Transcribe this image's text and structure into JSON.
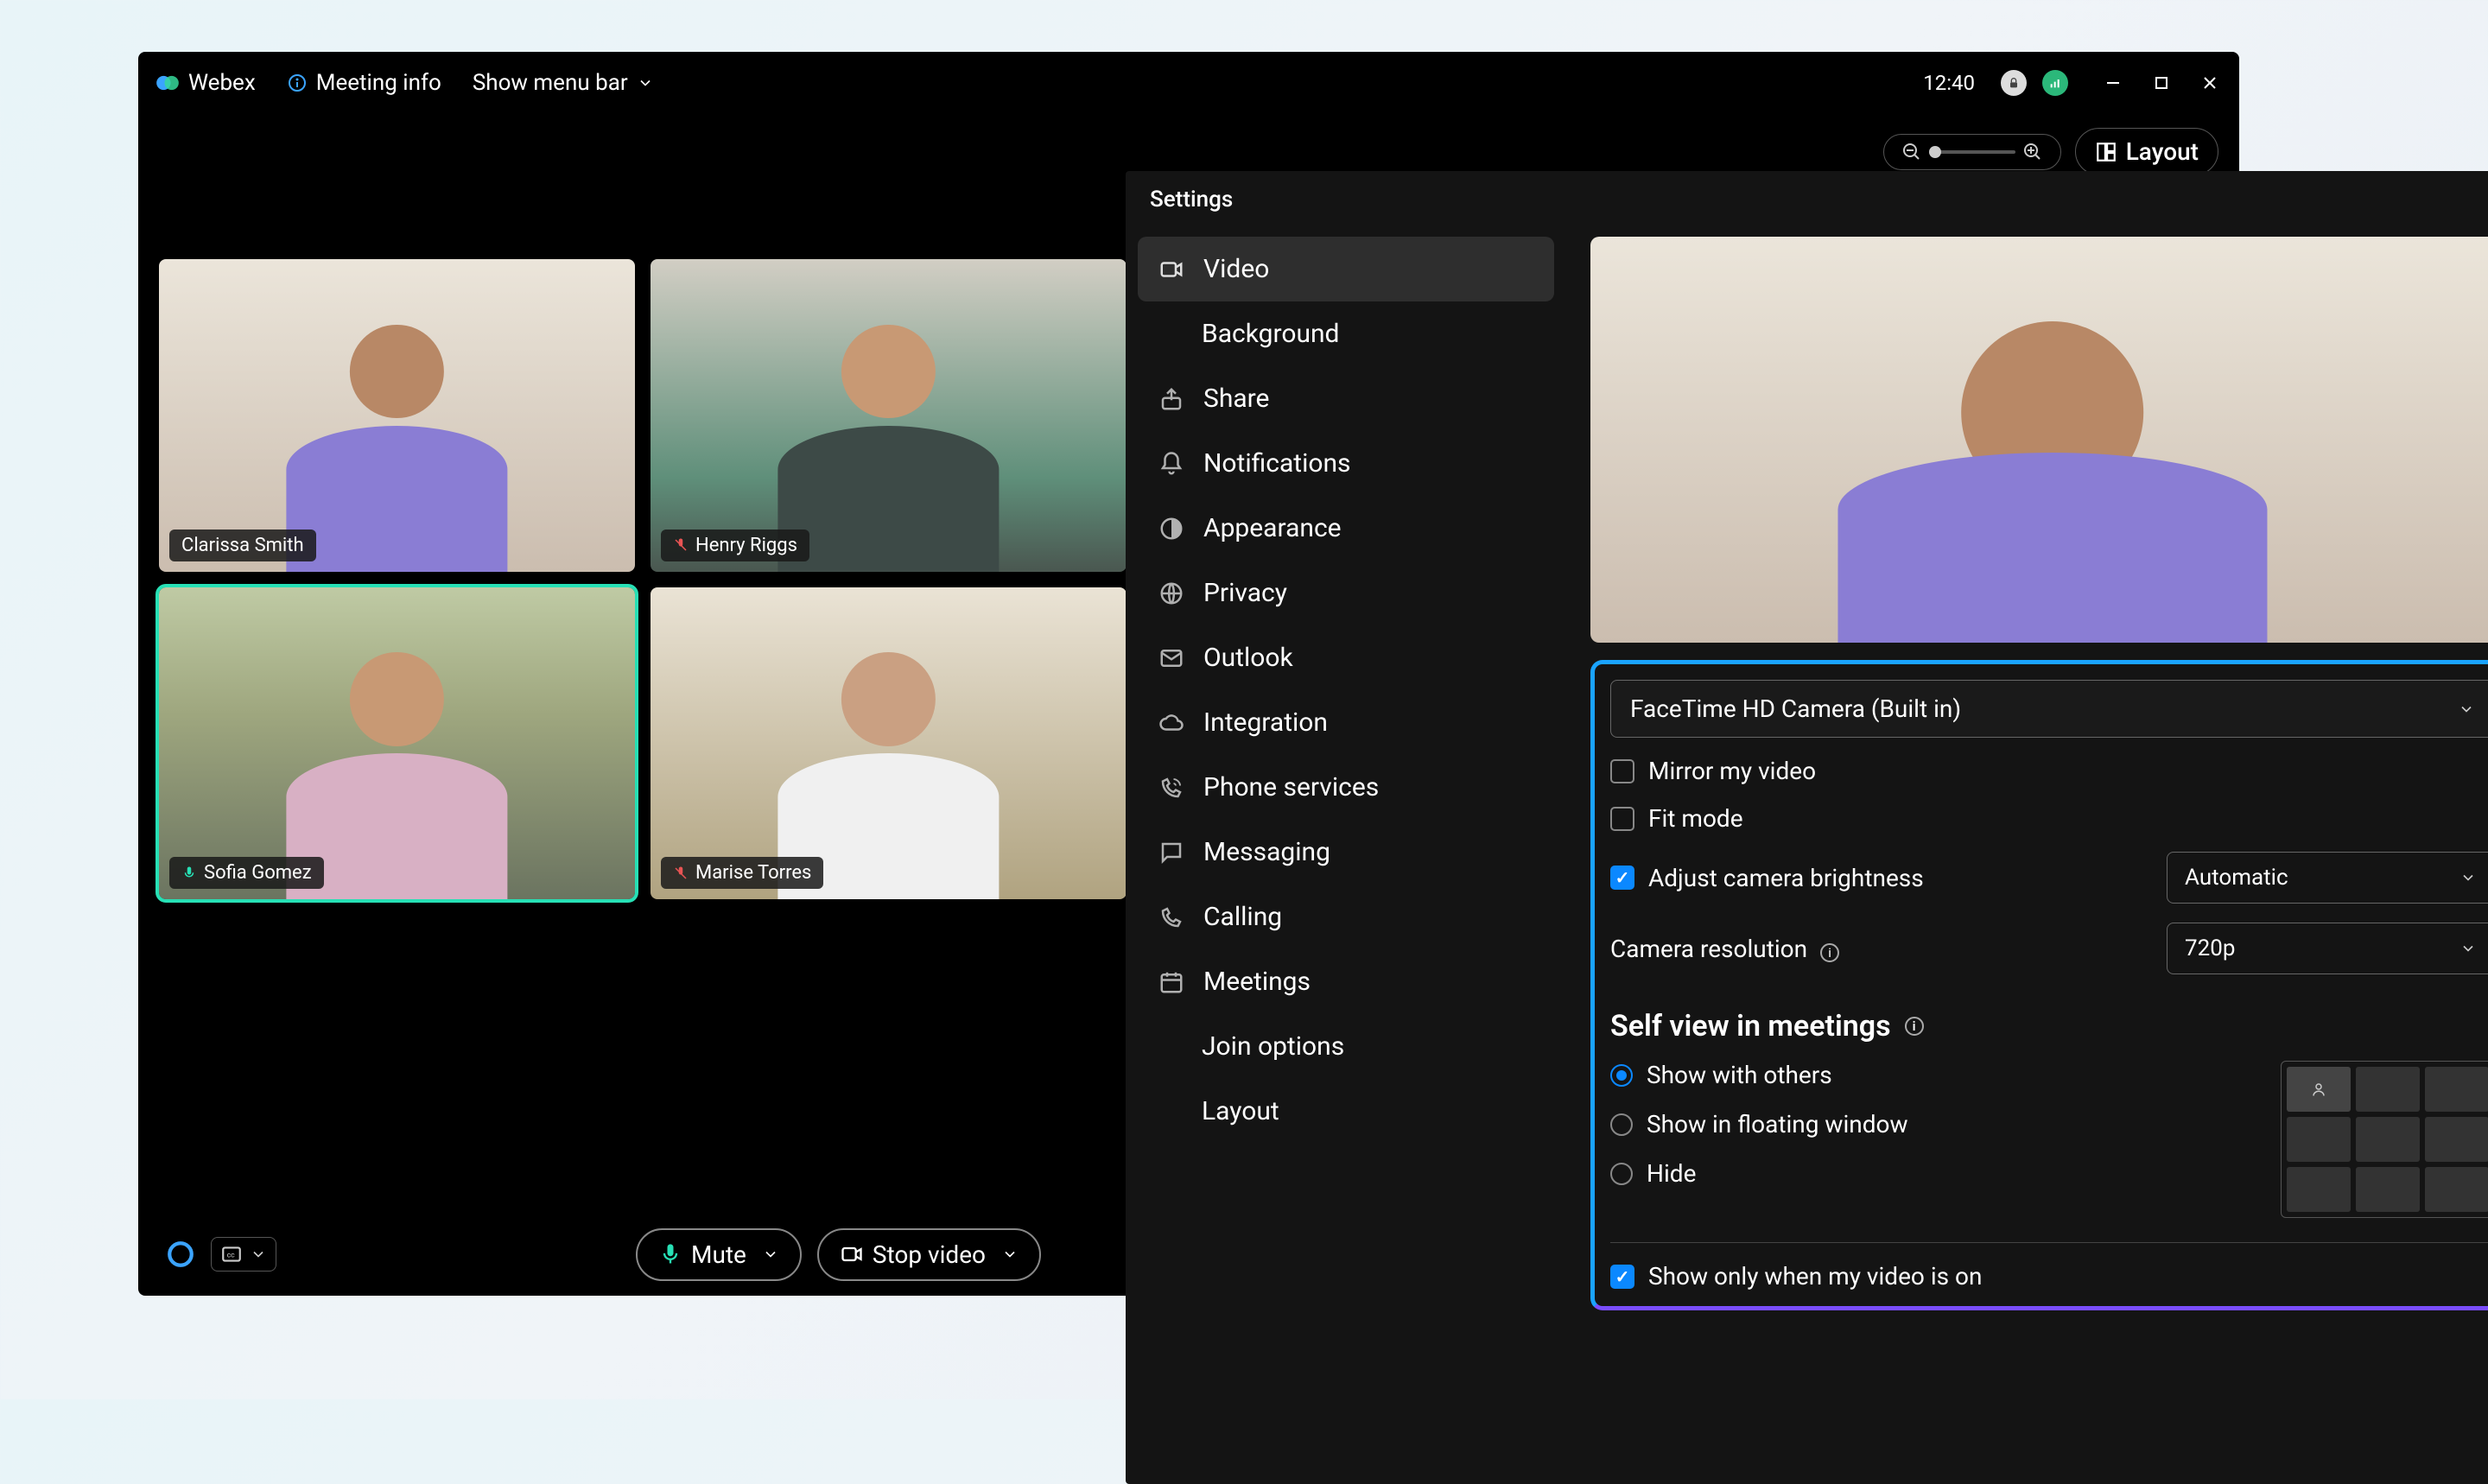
{
  "titlebar": {
    "app_name": "Webex",
    "meeting_info": "Meeting info",
    "show_menu": "Show menu bar",
    "time": "12:40"
  },
  "layout_btn": "Layout",
  "participants": [
    {
      "name": "Clarissa Smith",
      "muted": false,
      "active": false
    },
    {
      "name": "Henry Riggs",
      "muted": true,
      "active": false
    },
    {
      "name": "Sofia Gomez",
      "muted": false,
      "active": true
    },
    {
      "name": "Marise Torres",
      "muted": true,
      "active": false
    }
  ],
  "controls": {
    "mute": "Mute",
    "stop_video": "Stop video"
  },
  "settings": {
    "title": "Settings",
    "nav": [
      {
        "label": "Video",
        "icon": "camera"
      },
      {
        "label": "Background",
        "icon": "",
        "sub": true
      },
      {
        "label": "Share",
        "icon": "share"
      },
      {
        "label": "Notifications",
        "icon": "bell"
      },
      {
        "label": "Appearance",
        "icon": "appearance"
      },
      {
        "label": "Privacy",
        "icon": "privacy"
      },
      {
        "label": "Outlook",
        "icon": "outlook"
      },
      {
        "label": "Integration",
        "icon": "cloud"
      },
      {
        "label": "Phone services",
        "icon": "phone-signal"
      },
      {
        "label": "Messaging",
        "icon": "message"
      },
      {
        "label": "Calling",
        "icon": "call"
      },
      {
        "label": "Meetings",
        "icon": "meetings"
      },
      {
        "label": "Join options",
        "icon": "",
        "sub": true
      },
      {
        "label": "Layout",
        "icon": "",
        "sub": true
      }
    ],
    "camera_select": "FaceTime HD Camera (Built in)",
    "mirror": {
      "label": "Mirror my video",
      "checked": false
    },
    "fit": {
      "label": "Fit mode",
      "checked": false
    },
    "brightness": {
      "label": "Adjust camera brightness",
      "checked": true,
      "value": "Automatic"
    },
    "resolution": {
      "label": "Camera resolution",
      "value": "720p"
    },
    "selfview_title": "Self view in meetings",
    "selfview_options": [
      {
        "label": "Show with others",
        "checked": true
      },
      {
        "label": "Show in floating window",
        "checked": false
      },
      {
        "label": "Hide",
        "checked": false
      }
    ],
    "show_only": {
      "label": "Show only when my video is on",
      "checked": true
    }
  }
}
